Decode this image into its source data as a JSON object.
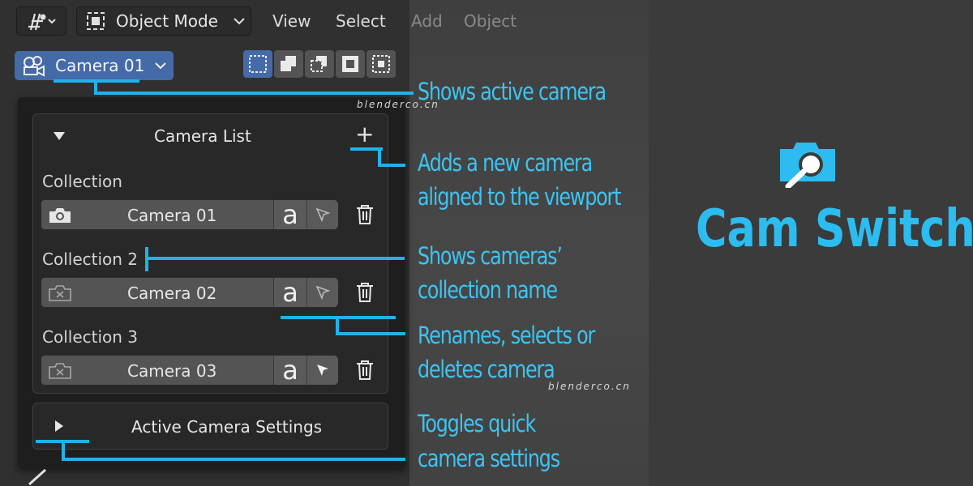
{
  "header": {
    "mode_label": "Object Mode",
    "menu": [
      "View",
      "Select",
      "Add",
      "Object"
    ]
  },
  "camera_selector": {
    "label": "Camera 01"
  },
  "panel": {
    "title": "Camera List",
    "rows": [
      {
        "collection": "Collection",
        "camera": "Camera 01",
        "rename_glyph": "a"
      },
      {
        "collection": "Collection 2",
        "camera": "Camera 02",
        "rename_glyph": "a"
      },
      {
        "collection": "Collection 3",
        "camera": "Camera 03",
        "rename_glyph": "a"
      }
    ],
    "settings_label": "Active Camera Settings"
  },
  "annotations": [
    "Shows active camera",
    "Adds a new camera",
    "aligned to the viewport",
    "Shows cameras’",
    "collection name",
    "Renames, selects or",
    "deletes camera",
    "Toggles quick",
    "camera settings"
  ],
  "brand": {
    "title": "Cam Switch"
  },
  "watermarks": [
    "blenderco.cn",
    "blenderco.cn"
  ],
  "colors": {
    "accent": "#3cc4f2",
    "callout_line": "#1fb3ea",
    "selector_blue": "#456aa8"
  }
}
